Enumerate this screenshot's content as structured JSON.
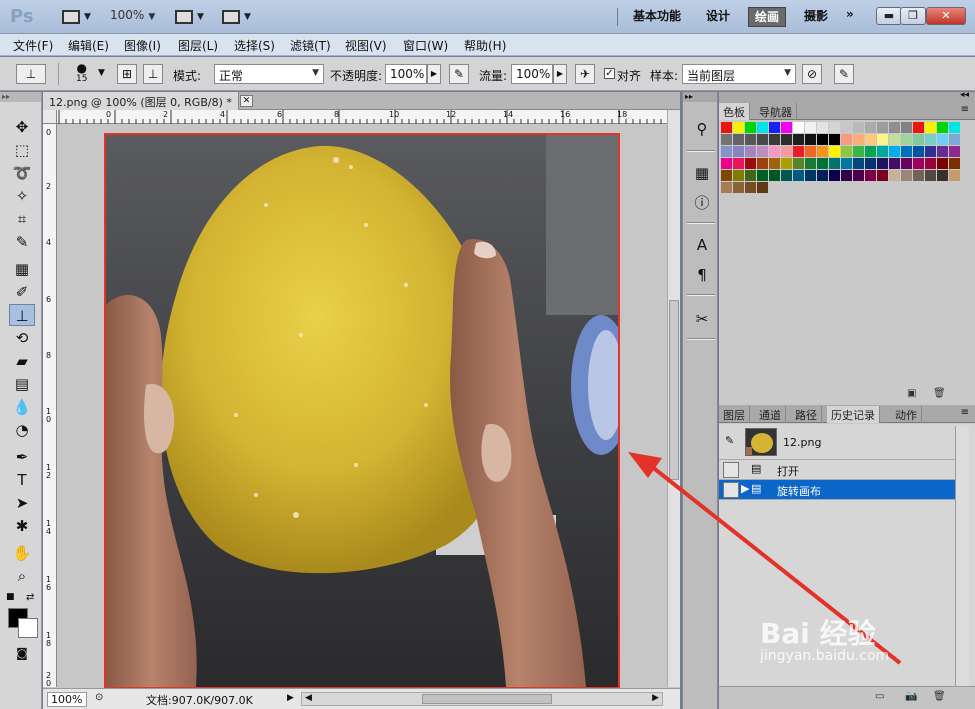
{
  "app": {
    "logo": "Ps",
    "zoom_label": "100%",
    "workspaces": [
      "基本功能",
      "设计",
      "绘画",
      "摄影"
    ],
    "active_workspace": "绘画",
    "more_label": "»",
    "window_buttons": {
      "minimize": "▬",
      "restore": "❐",
      "close": "✕"
    }
  },
  "menu": [
    "文件(F)",
    "编辑(E)",
    "图像(I)",
    "图层(L)",
    "选择(S)",
    "滤镜(T)",
    "视图(V)",
    "窗口(W)",
    "帮助(H)"
  ],
  "options": {
    "brush_size": "15",
    "mode_label": "模式:",
    "mode_value": "正常",
    "opacity_label": "不透明度:",
    "opacity_value": "100%",
    "flow_label": "流量:",
    "flow_value": "100%",
    "align_label": "对齐",
    "align_checked": true,
    "sample_label": "样本:",
    "sample_value": "当前图层"
  },
  "document": {
    "tab_title": "12.png @ 100% (图层 0, RGB/8) *",
    "ruler_top": [
      "0",
      "2",
      "4",
      "6",
      "8",
      "10",
      "12",
      "14",
      "16",
      "18"
    ],
    "ruler_left": [
      "0",
      "2",
      "4",
      "6",
      "8",
      "1\n0",
      "1\n2",
      "1\n4",
      "1\n6",
      "1\n8",
      "2\n0"
    ],
    "status_zoom": "100%",
    "status_doc": "文档:907.0K/907.0K"
  },
  "panels": {
    "top_tabs": [
      "色板",
      "导航器"
    ],
    "top_active": "色板",
    "bottom_tabs": [
      "图层",
      "通道",
      "路径",
      "历史记录",
      "动作"
    ],
    "bottom_active": "历史记录",
    "history": {
      "snapshot": "12.png",
      "steps": [
        {
          "label": "打开",
          "selected": false
        },
        {
          "label": "旋转画布",
          "selected": true
        }
      ]
    }
  },
  "swatches": [
    "#e8160f",
    "#f6f200",
    "#00d500",
    "#00e5e6",
    "#1422f5",
    "#f200f2",
    "#ffffff",
    "#f1f1f1",
    "#e3e3e3",
    "#d5d5d5",
    "#c7c7c7",
    "#b9b9b9",
    "#ababab",
    "#9d9d9d",
    "#8f8f8f",
    "#818181",
    "#e8160f",
    "#f6f200",
    "#00d500",
    "#00e5e6",
    "#737373",
    "#656565",
    "#575757",
    "#494949",
    "#3b3b3b",
    "#2d2d2d",
    "#1f1f1f",
    "#111111",
    "#030303",
    "#000000",
    "#f79c7e",
    "#fbae79",
    "#fdc880",
    "#fff58a",
    "#c4df9b",
    "#a2d39c",
    "#82ca9c",
    "#7bcdc7",
    "#6dcff6",
    "#7ea7d8",
    "#8493ca",
    "#8882be",
    "#a187be",
    "#bc8dbf",
    "#f49ac2",
    "#f6989d",
    "#ed1c24",
    "#f26522",
    "#f7941d",
    "#fff200",
    "#8dc63f",
    "#39b54a",
    "#00a651",
    "#00a99d",
    "#00aeef",
    "#0072bc",
    "#0054a6",
    "#2e3192",
    "#662d91",
    "#92278f",
    "#ec008c",
    "#ed145b",
    "#9e0b0f",
    "#a0410d",
    "#a3620a",
    "#aba000",
    "#598527",
    "#197b30",
    "#007236",
    "#00746b",
    "#0076a3",
    "#004a80",
    "#003471",
    "#1b1464",
    "#440e62",
    "#630460",
    "#9e005d",
    "#9e0039",
    "#790000",
    "#7b2e00",
    "#7d4900",
    "#827b00",
    "#406618",
    "#005e20",
    "#005826",
    "#005952",
    "#005b7f",
    "#003663",
    "#002157",
    "#0d004c",
    "#32004b",
    "#4b0049",
    "#7b0046",
    "#7a0026",
    "#c7b299",
    "#998675",
    "#736357",
    "#534741",
    "#37302d",
    "#c69c6d",
    "#a67c52",
    "#8c6239",
    "#754c24",
    "#603913"
  ],
  "colors": {
    "accent_red": "#e53228",
    "selection_blue": "#0a66c8",
    "active_workspace_bg": "#6a6a6a"
  },
  "watermark": {
    "text": "Bai 经验",
    "url": "jingyan.baidu.com"
  }
}
